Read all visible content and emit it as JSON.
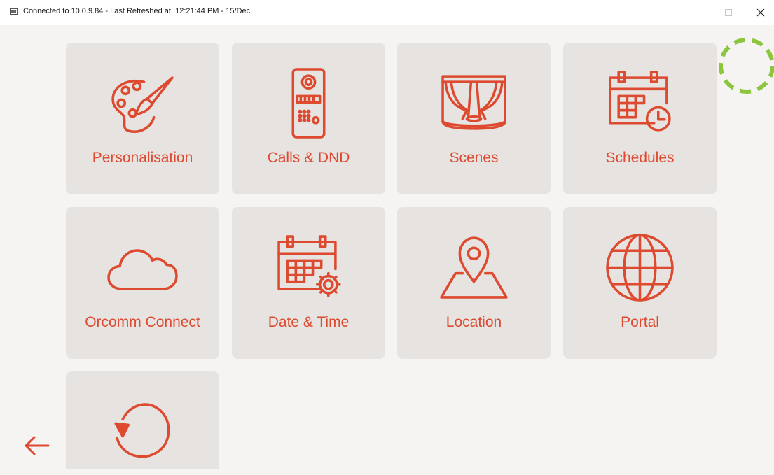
{
  "window": {
    "title": "Connected to 10.0.9.84 - Last Refreshed at: 12:21:44 PM - 15/Dec",
    "controls": [
      "minimize",
      "maximize",
      "close"
    ]
  },
  "colors": {
    "accent": "#dd4a2f",
    "tile_bg": "#e6e3e1",
    "page_bg": "#f5f4f3",
    "spinner": "#8cc63f"
  },
  "tiles": [
    {
      "label": "Personalisation",
      "icon": "palette-icon"
    },
    {
      "label": "Calls & DND",
      "icon": "intercom-icon"
    },
    {
      "label": "Scenes",
      "icon": "stage-curtain-icon"
    },
    {
      "label": "Schedules",
      "icon": "calendar-clock-icon"
    },
    {
      "label": "Orcomm Connect",
      "icon": "cloud-icon"
    },
    {
      "label": "Date & Time",
      "icon": "calendar-gear-icon"
    },
    {
      "label": "Location",
      "icon": "map-pin-icon"
    },
    {
      "label": "Portal",
      "icon": "globe-icon"
    },
    {
      "label": "",
      "icon": "reset-icon"
    }
  ],
  "back_icon": "arrow-left-icon",
  "loading_icon": "loading-spinner-icon"
}
